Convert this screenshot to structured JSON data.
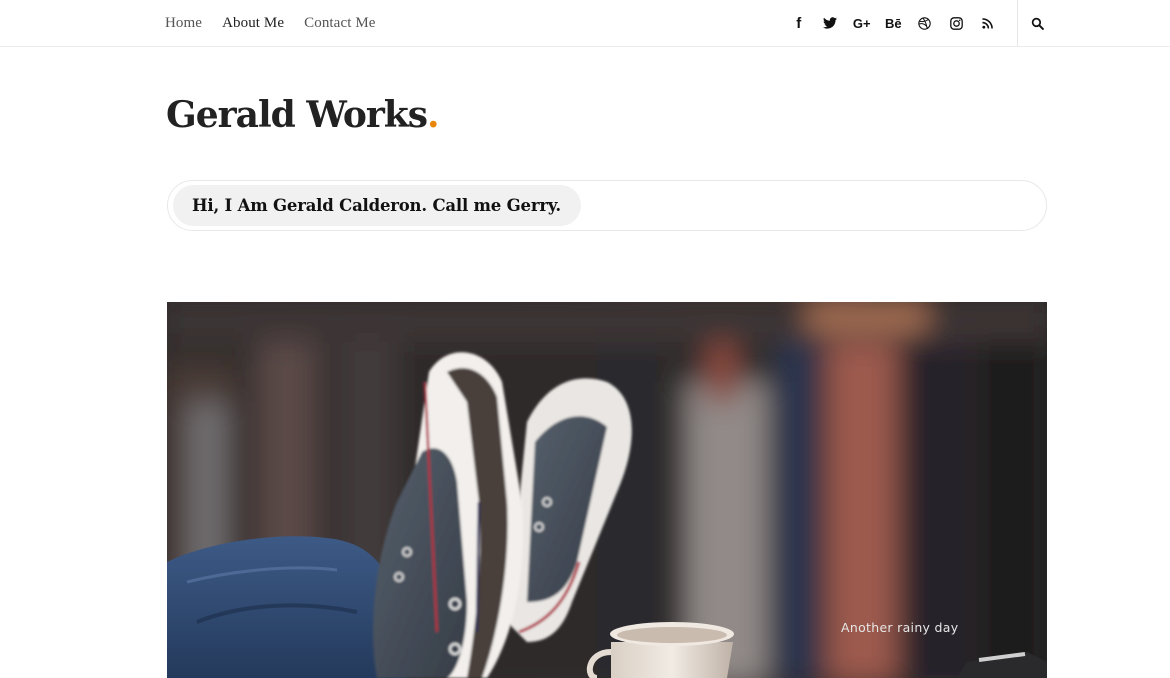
{
  "nav": {
    "items": [
      {
        "label": "Home"
      },
      {
        "label": "About Me"
      },
      {
        "label": "Contact Me"
      }
    ]
  },
  "social": {
    "icons": [
      {
        "icon": "facebook-icon",
        "glyph": "f"
      },
      {
        "icon": "twitter-icon"
      },
      {
        "icon": "google-plus-icon",
        "glyph": "G+"
      },
      {
        "icon": "behance-icon",
        "glyph": "Bē"
      },
      {
        "icon": "dribbble-icon"
      },
      {
        "icon": "instagram-icon"
      },
      {
        "icon": "rss-icon"
      }
    ],
    "search_icon": "search-icon"
  },
  "site": {
    "title": "Gerald Works",
    "title_dot": ".",
    "accent_color": "#e8870c",
    "tagline": "Hi, I Am Gerald Calderon. Call me Gerry."
  },
  "hero": {
    "caption": "Another rainy day"
  }
}
